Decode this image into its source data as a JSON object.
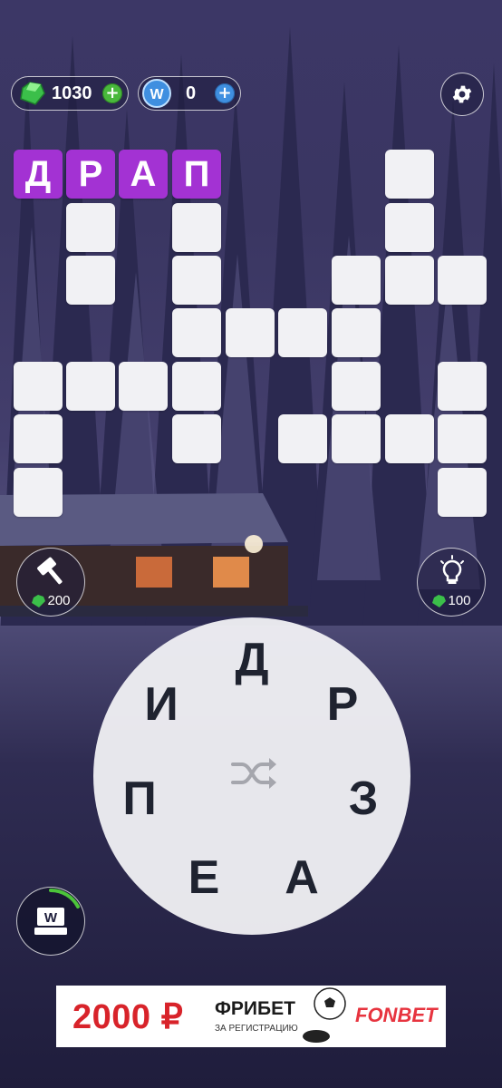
{
  "currency": {
    "gems": "1030",
    "coins": "0",
    "gems_icon": "gem-icon",
    "coins_icon": "w-coin-icon",
    "add_icon": "plus-icon"
  },
  "settings": {
    "icon": "gear-icon"
  },
  "crossword": {
    "solved_word": [
      "Д",
      "Р",
      "А",
      "П"
    ],
    "accent_color": "#a332d3"
  },
  "boosters": {
    "hammer": {
      "icon": "hammer-icon",
      "cost": "200"
    },
    "hint": {
      "icon": "lightbulb-icon",
      "cost": "100"
    }
  },
  "wheel": {
    "letters": [
      "Д",
      "Р",
      "З",
      "А",
      "Е",
      "П",
      "И"
    ],
    "shuffle_icon": "shuffle-icon"
  },
  "daily": {
    "icon": "w-chest-icon"
  },
  "ad": {
    "amount": "2000 ₽",
    "title": "ФРИБЕТ",
    "subtitle": "ЗА РЕГИСТРАЦИЮ",
    "brand": "FONBET"
  }
}
